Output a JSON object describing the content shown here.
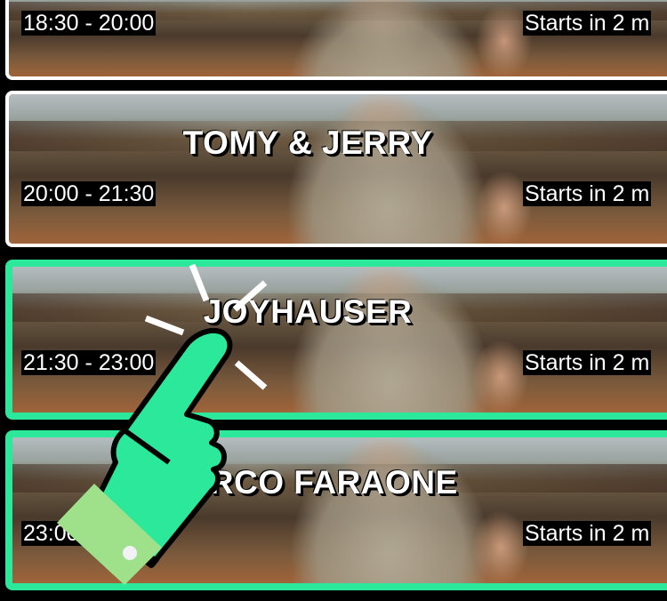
{
  "events": [
    {
      "title": "",
      "time": "18:30 - 20:00",
      "starts": "Starts in 2 m"
    },
    {
      "title": "TOMY & JERRY",
      "time": "20:00 - 21:30",
      "starts": "Starts in 2 m"
    },
    {
      "title": "JOYHAUSER",
      "time": "21:30 - 23:00",
      "starts": "Starts in 2 m"
    },
    {
      "title": "MARCO FARAONE",
      "time": "23:00 - 00:30",
      "starts": "Starts in 2 m"
    }
  ],
  "colors": {
    "selected_border": "#2be89a",
    "default_border": "#ffffff",
    "hand": "#2be89a",
    "cuff": "#9fe08a"
  },
  "overlay_icon": "tap-hand-icon"
}
